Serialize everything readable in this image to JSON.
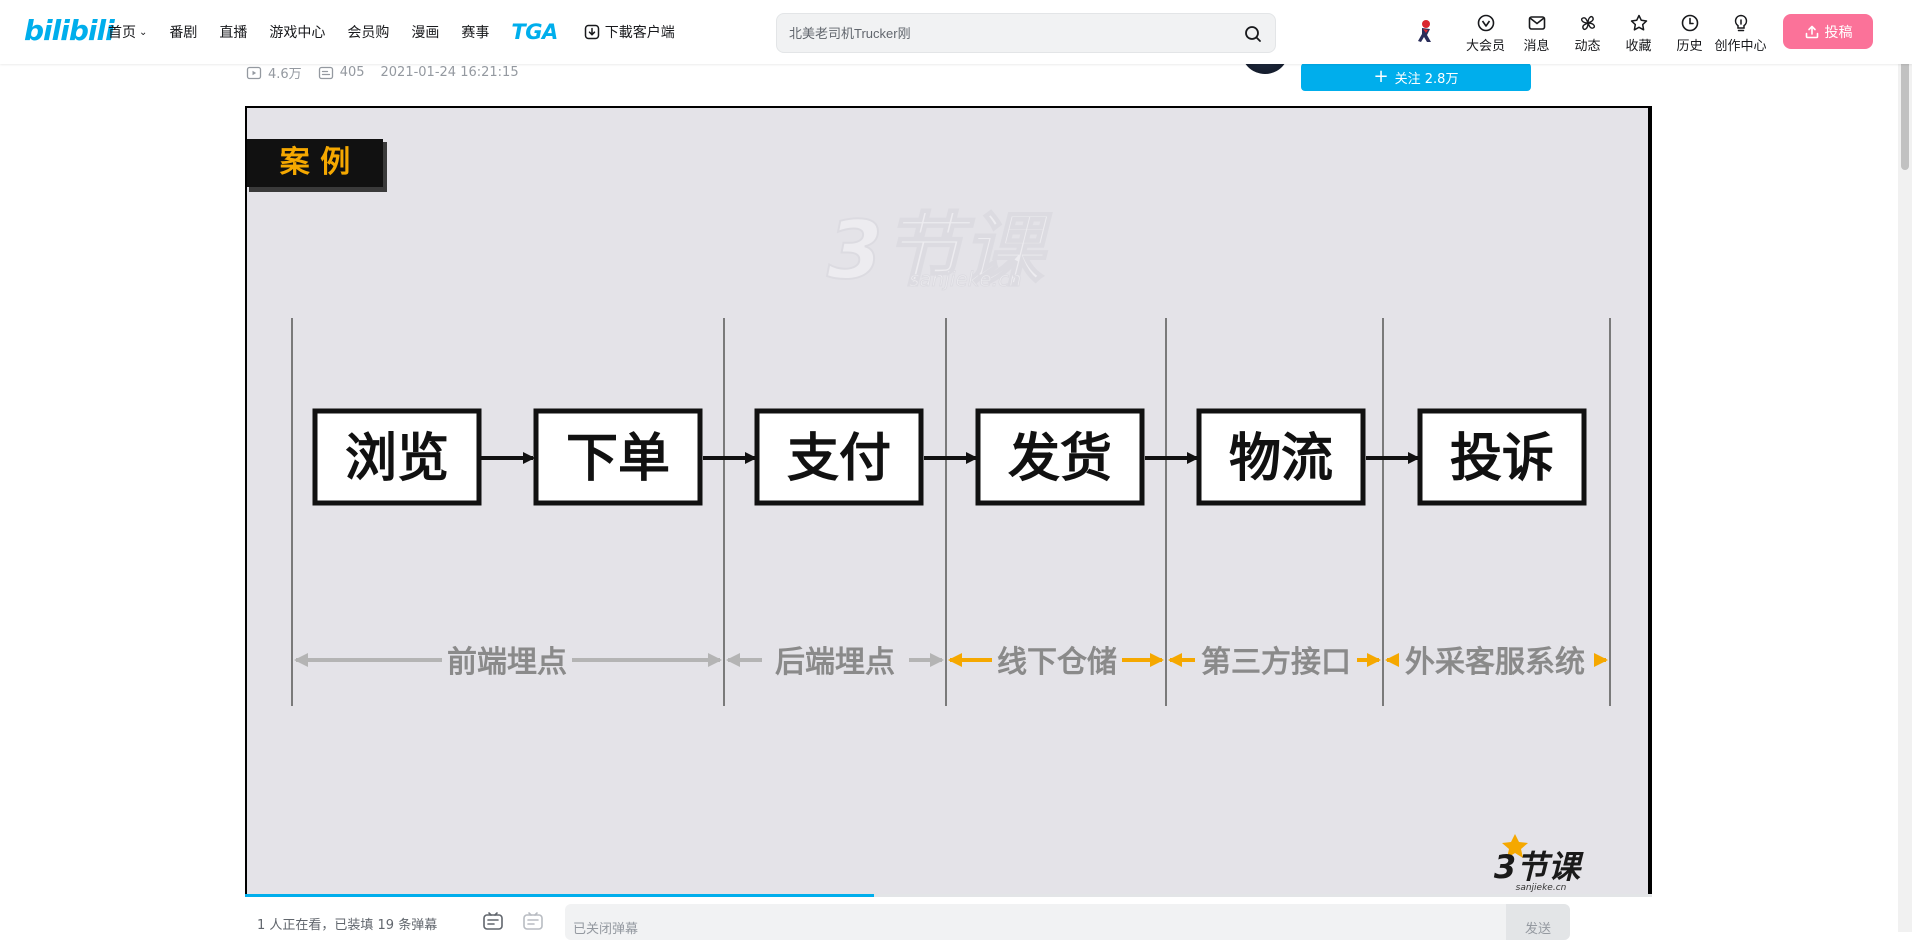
{
  "header": {
    "logo": "bilibili",
    "nav": [
      {
        "label": "首页",
        "has_dropdown": true
      },
      {
        "label": "番剧"
      },
      {
        "label": "直播"
      },
      {
        "label": "游戏中心"
      },
      {
        "label": "会员购"
      },
      {
        "label": "漫画"
      },
      {
        "label": "赛事"
      }
    ],
    "tga": "TGA",
    "download": "下載客户端",
    "search": {
      "placeholder": "北美老司机Trucker刚",
      "icon": "search-icon"
    },
    "right": [
      {
        "label": "大会员",
        "icon": "vip-icon"
      },
      {
        "label": "消息",
        "icon": "message-icon"
      },
      {
        "label": "动态",
        "icon": "dynamic-icon"
      },
      {
        "label": "收藏",
        "icon": "star-icon"
      },
      {
        "label": "历史",
        "icon": "clock-icon"
      },
      {
        "label": "创作中心",
        "icon": "bulb-icon"
      }
    ],
    "upload": "投稿"
  },
  "video_meta": {
    "views": "4.6万",
    "danmaku_count": "405",
    "date": "2021-01-24 16:21:15"
  },
  "uploader": {
    "follow": "关注 2.8万"
  },
  "slide": {
    "tag": "案 例",
    "watermark_cn": "3节课",
    "watermark_en": "sanjieke.cn",
    "steps": [
      "浏览",
      "下单",
      "支付",
      "发货",
      "物流",
      "投诉"
    ],
    "segments": [
      "前端埋点",
      "后端埋点",
      "线下仓储",
      "第三方接口",
      "外采客服系统"
    ],
    "corner_logo": "3节课",
    "corner_sub": "sanjieke.cn"
  },
  "player": {
    "progress": 0.447
  },
  "danmaku": {
    "viewers": "1 人正在看，已装填 19 条弹幕",
    "input_placeholder": "已关闭弹幕",
    "send": "发送"
  },
  "colors": {
    "brand": "#00aeec",
    "pink": "#fb7299",
    "arrow_orange": "#f5a800",
    "arrow_gray": "#b4b4b4"
  }
}
